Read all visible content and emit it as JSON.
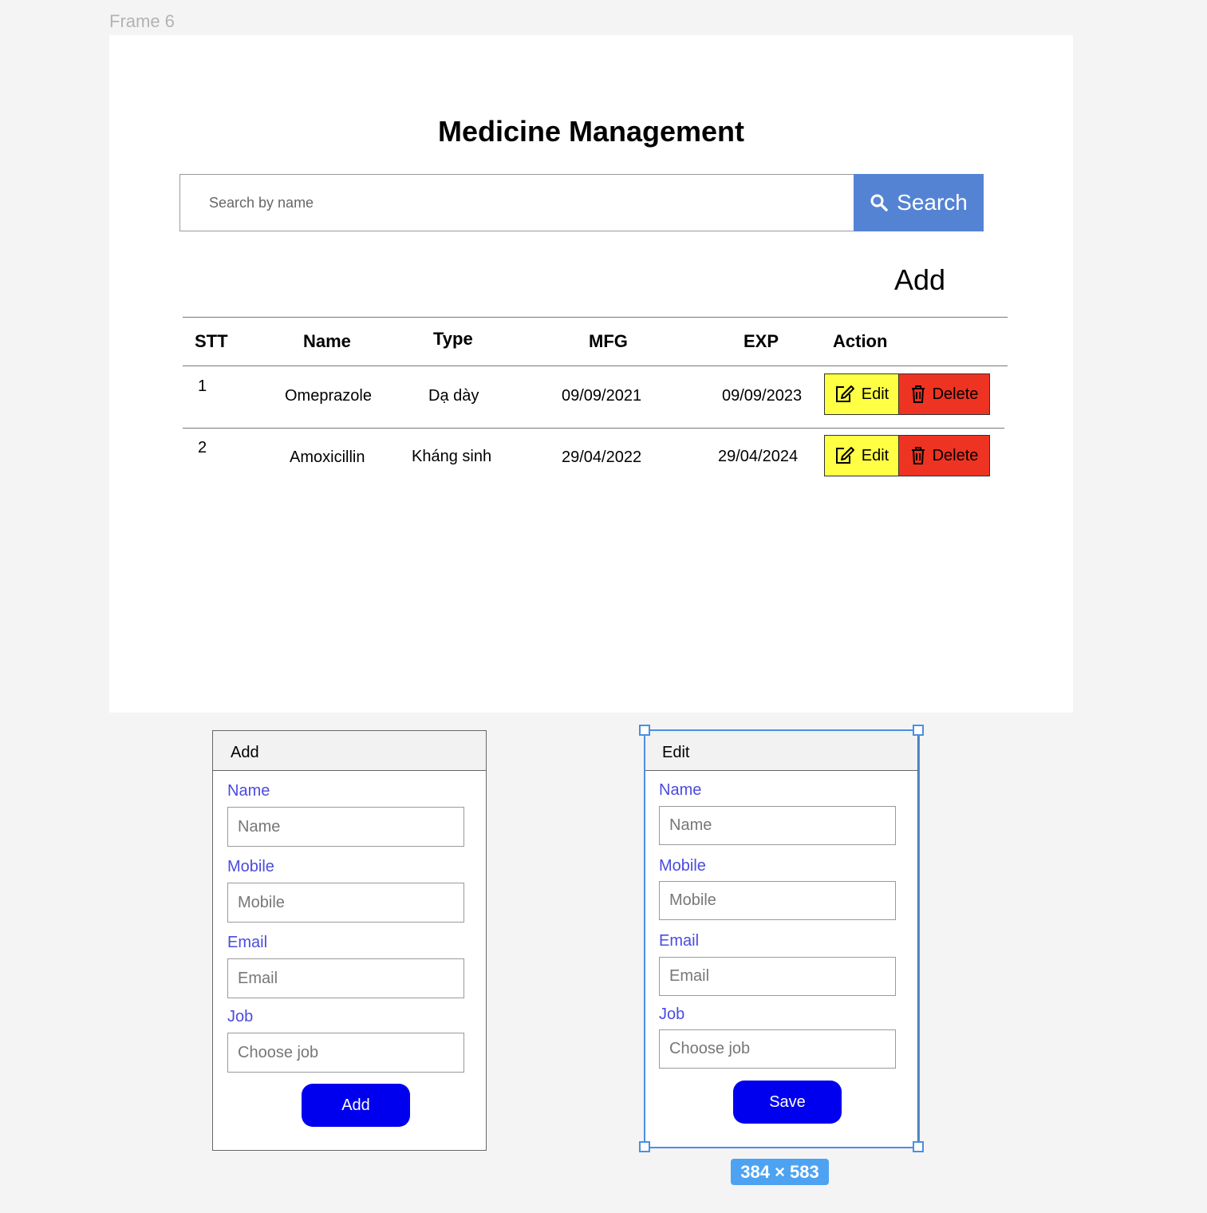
{
  "frame_label": "Frame 6",
  "page": {
    "title": "Medicine Management",
    "search": {
      "placeholder": "Search by name",
      "button_label": "Search"
    },
    "add_label": "Add",
    "table": {
      "headers": [
        "STT",
        "Name",
        "Type",
        "MFG",
        "EXP",
        "Action"
      ],
      "rows": [
        {
          "stt": "1",
          "name": "Omeprazole",
          "type": "Dạ dày",
          "mfg": "09/09/2021",
          "exp": "09/09/2023"
        },
        {
          "stt": "2",
          "name": "Amoxicillin",
          "type": "Kháng sinh",
          "mfg": "29/04/2022",
          "exp": "29/04/2024"
        }
      ],
      "edit_label": "Edit",
      "delete_label": "Delete"
    }
  },
  "add_dialog": {
    "title": "Add",
    "fields": [
      {
        "label": "Name",
        "placeholder": "Name"
      },
      {
        "label": "Mobile",
        "placeholder": "Mobile"
      },
      {
        "label": "Email",
        "placeholder": "Email"
      },
      {
        "label": "Job",
        "placeholder": "Choose job"
      }
    ],
    "submit_label": "Add"
  },
  "edit_dialog": {
    "title": "Edit",
    "fields": [
      {
        "label": "Name",
        "placeholder": "Name"
      },
      {
        "label": "Mobile",
        "placeholder": "Mobile"
      },
      {
        "label": "Email",
        "placeholder": "Email"
      },
      {
        "label": "Job",
        "placeholder": "Choose job"
      }
    ],
    "submit_label": "Save"
  },
  "selection_size": "384 × 583",
  "colors": {
    "search_button": "#5583d4",
    "edit_button": "#ffff44",
    "delete_button": "#ee3322",
    "field_label": "#4b4be0",
    "primary_button": "#0000ee",
    "selection": "#4a90e2"
  },
  "icons": [
    "search-icon",
    "edit-icon",
    "trash-icon"
  ]
}
